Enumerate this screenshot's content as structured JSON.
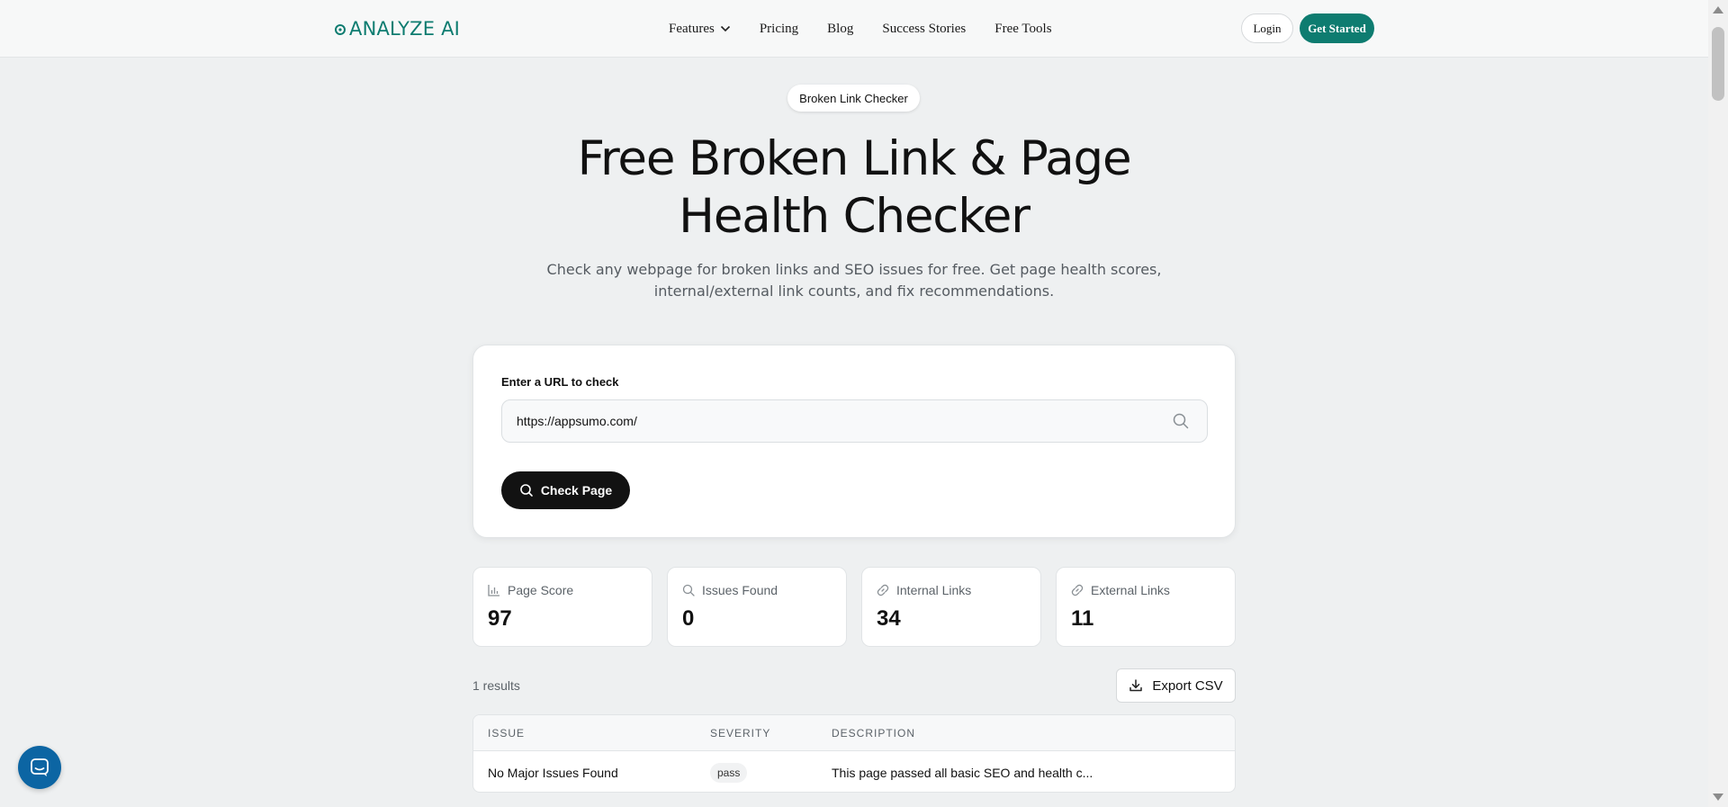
{
  "header": {
    "logo_text": "ANALYZE AI",
    "nav": [
      {
        "label": "Features",
        "has_dropdown": true
      },
      {
        "label": "Pricing"
      },
      {
        "label": "Blog"
      },
      {
        "label": "Success Stories"
      },
      {
        "label": "Free Tools"
      }
    ],
    "login_label": "Login",
    "cta_label": "Get Started"
  },
  "hero": {
    "pill": "Broken Link Checker",
    "title_line1": "Free Broken Link & Page",
    "title_line2": "Health Checker",
    "subtitle_line1": "Check any webpage for broken links and SEO issues for free. Get page health scores,",
    "subtitle_line2": "internal/external link counts, and fix recommendations."
  },
  "form": {
    "label": "Enter a URL to check",
    "url_value": "https://appsumo.com/",
    "button_label": "Check Page"
  },
  "stats": [
    {
      "label": "Page Score",
      "value": "97",
      "icon": "bar-chart-icon"
    },
    {
      "label": "Issues Found",
      "value": "0",
      "icon": "search-icon"
    },
    {
      "label": "Internal Links",
      "value": "34",
      "icon": "link-icon"
    },
    {
      "label": "External Links",
      "value": "11",
      "icon": "link-icon"
    }
  ],
  "results": {
    "count_text": "1 results",
    "export_label": "Export CSV",
    "columns": [
      "Issue",
      "Severity",
      "Description"
    ],
    "rows": [
      {
        "issue": "No Major Issues Found",
        "severity": "pass",
        "description": "This page passed all basic SEO and health c..."
      }
    ]
  },
  "colors": {
    "brand": "#0e7c70",
    "background": "#eef0f1",
    "button_dark": "#121212",
    "chat": "#0c65a3"
  }
}
